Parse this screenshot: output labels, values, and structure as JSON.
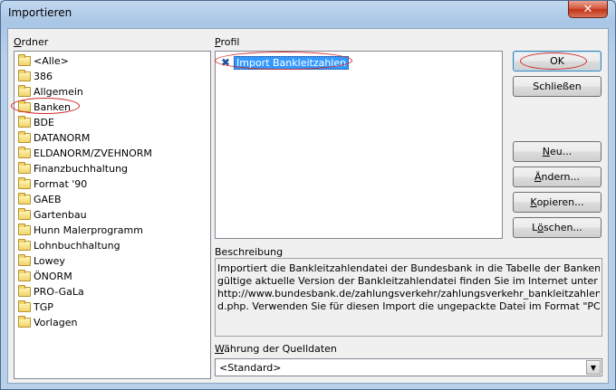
{
  "window": {
    "title": "Importieren",
    "close_glyph": "✕"
  },
  "folders": {
    "label_prefix": "",
    "label_accel": "O",
    "label_rest": "rdner",
    "items": [
      {
        "label": "<Alle>"
      },
      {
        "label": "386"
      },
      {
        "label": "Allgemein"
      },
      {
        "label": "Banken"
      },
      {
        "label": "BDE"
      },
      {
        "label": "DATANORM"
      },
      {
        "label": "ELDANORM/ZVEHNORM"
      },
      {
        "label": "Finanzbuchhaltung"
      },
      {
        "label": "Format '90"
      },
      {
        "label": "GAEB"
      },
      {
        "label": "Gartenbau"
      },
      {
        "label": "Hunn Malerprogramm"
      },
      {
        "label": "Lohnbuchhaltung"
      },
      {
        "label": "Lowey"
      },
      {
        "label": "ÖNORM"
      },
      {
        "label": "PRO-GaLa"
      },
      {
        "label": "TGP"
      },
      {
        "label": "Vorlagen"
      }
    ]
  },
  "profile": {
    "label_accel": "P",
    "label_rest": "rofil",
    "items": [
      {
        "label": "Import Bankleitzahlen",
        "selected": true
      }
    ]
  },
  "buttons": {
    "ok": "OK",
    "close": "Schließen",
    "new_accel": "N",
    "new_rest": "eu...",
    "edit_accel": "Ä",
    "edit_rest": "ndern...",
    "copy_accel": "K",
    "copy_rest": "opieren...",
    "delete_prefix": "L",
    "delete_accel": "ö",
    "delete_rest": "schen..."
  },
  "description": {
    "label": "Beschreibung",
    "lines": [
      "Importiert die Bankleitzahlendatei der Bundesbank in die Tabelle der Banken. Die jeweils",
      "gültige aktuelle Version der Bankleitzahlendatei finden Sie im Internet unter",
      "http://www.bundesbank.de/zahlungsverkehr/zahlungsverkehr_bankleitzahlen_downlo a",
      "d.php. Verwenden Sie für diesen Import die ungepackte Datei im Format \"PC Text\"."
    ]
  },
  "currency": {
    "label_accel": "W",
    "label_rest": "ährung der Quelldaten",
    "value": "<Standard>"
  },
  "colors": {
    "selection": "#3399ff",
    "annotation": "#d1282b"
  }
}
